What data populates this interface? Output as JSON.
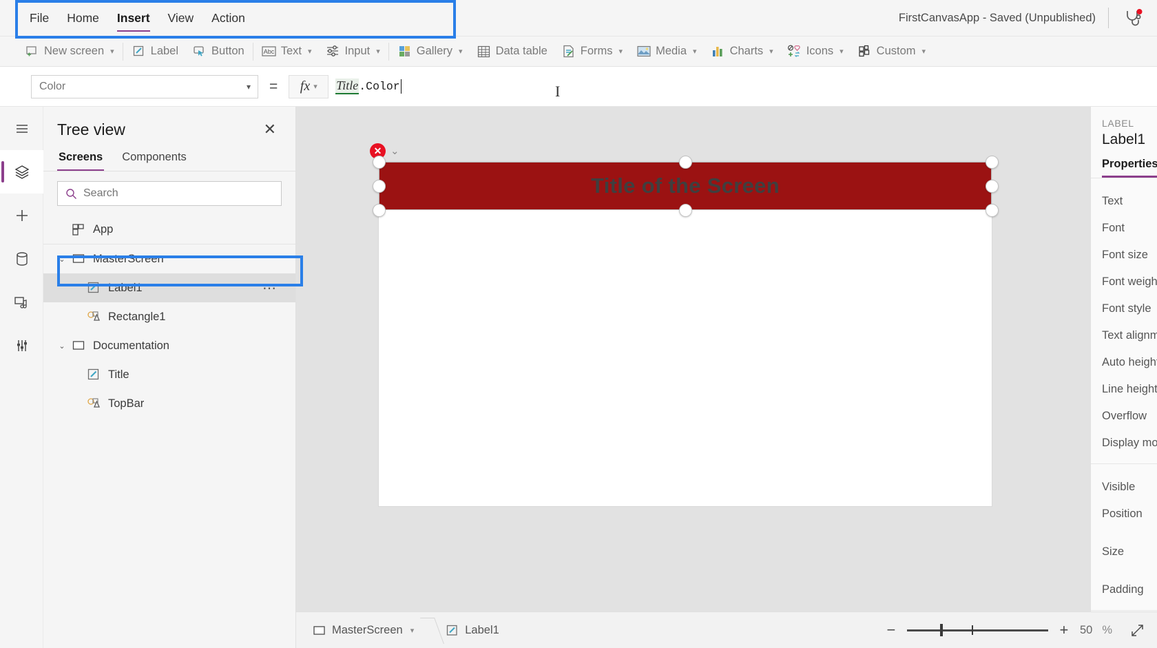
{
  "menu": {
    "items": [
      {
        "label": "File",
        "active": false
      },
      {
        "label": "Home",
        "active": false
      },
      {
        "label": "Insert",
        "active": true
      },
      {
        "label": "View",
        "active": false
      },
      {
        "label": "Action",
        "active": false
      }
    ],
    "app_state": "FirstCanvasApp - Saved (Unpublished)",
    "health_icon": "stethoscope-icon"
  },
  "ribbon": {
    "items": [
      {
        "label": "New screen",
        "icon": "new-screen-icon",
        "caret": true
      },
      {
        "label": "Label",
        "icon": "label-icon",
        "caret": false
      },
      {
        "label": "Button",
        "icon": "button-icon",
        "caret": false
      },
      {
        "label": "Text",
        "icon": "text-icon",
        "caret": true
      },
      {
        "label": "Input",
        "icon": "input-icon",
        "caret": true
      },
      {
        "label": "Gallery",
        "icon": "gallery-icon",
        "caret": true
      },
      {
        "label": "Data table",
        "icon": "data-table-icon",
        "caret": false
      },
      {
        "label": "Forms",
        "icon": "forms-icon",
        "caret": true
      },
      {
        "label": "Media",
        "icon": "media-icon",
        "caret": true
      },
      {
        "label": "Charts",
        "icon": "charts-icon",
        "caret": true
      },
      {
        "label": "Icons",
        "icon": "icons-icon",
        "caret": true
      },
      {
        "label": "Custom",
        "icon": "custom-icon",
        "caret": true
      }
    ]
  },
  "formula_bar": {
    "property_selected": "Color",
    "equals": "=",
    "fx_label": "fx",
    "formula_table_token": "Title",
    "formula_rest_token": ".Color",
    "highlighted": true
  },
  "rail": {
    "items": [
      {
        "name": "hamburger-menu-icon",
        "label": "Menu",
        "active": false
      },
      {
        "name": "tree-view-icon",
        "label": "Tree view",
        "active": true
      },
      {
        "name": "insert-plus-icon",
        "label": "Insert",
        "active": false
      },
      {
        "name": "data-icon",
        "label": "Data",
        "active": false
      },
      {
        "name": "media-icon",
        "label": "Media",
        "active": false
      },
      {
        "name": "variables-icon",
        "label": "Variables",
        "active": false
      }
    ]
  },
  "tree_view": {
    "title": "Tree view",
    "close_label": "✕",
    "tabs": [
      {
        "label": "Screens",
        "active": true
      },
      {
        "label": "Components",
        "active": false
      }
    ],
    "search_placeholder": "Search",
    "search_value": "",
    "nodes": [
      {
        "label": "App",
        "icon": "app-icon",
        "level": 0,
        "twisty": "",
        "selected": false,
        "ellipsis": false
      },
      {
        "label": "MasterScreen",
        "icon": "screen-icon",
        "level": 0,
        "twisty": "⌄",
        "selected": false,
        "ellipsis": false
      },
      {
        "label": "Label1",
        "icon": "label-control-icon",
        "level": 1,
        "twisty": "",
        "selected": true,
        "ellipsis": true
      },
      {
        "label": "Rectangle1",
        "icon": "shape-control-icon",
        "level": 1,
        "twisty": "",
        "selected": false,
        "ellipsis": false
      },
      {
        "label": "Documentation",
        "icon": "screen-icon",
        "level": 0,
        "twisty": "⌄",
        "selected": false,
        "ellipsis": false
      },
      {
        "label": "Title",
        "icon": "label-control-icon",
        "level": 1,
        "twisty": "",
        "selected": false,
        "ellipsis": false
      },
      {
        "label": "TopBar",
        "icon": "shape-control-icon",
        "level": 1,
        "twisty": "",
        "selected": false,
        "ellipsis": false
      }
    ]
  },
  "canvas": {
    "label_text": "Title of the Screen",
    "label_fill": "#9b1212",
    "label_text_color": "#3f3f3f",
    "screen_background": "#ffffff",
    "error_badge": "✕",
    "error_chevron": "⌄"
  },
  "properties_panel": {
    "kind": "LABEL",
    "name": "Label1",
    "tab": "Properties",
    "group1": [
      "Text",
      "Font",
      "Font size",
      "Font weight",
      "Font style",
      "Text alignment",
      "Auto height",
      "Line height",
      "Overflow",
      "Display mode"
    ],
    "group2": [
      "Visible",
      "Position",
      "Size",
      "Padding"
    ]
  },
  "status_bar": {
    "breadcrumbs": [
      {
        "label": "MasterScreen",
        "icon": "screen-icon",
        "caret": true
      },
      {
        "label": "Label1",
        "icon": "label-control-icon",
        "caret": false
      }
    ],
    "zoom_minus": "−",
    "zoom_plus": "+",
    "zoom_value": "50",
    "zoom_unit": "%",
    "fit_icon": "fit-to-screen-icon"
  },
  "colors": {
    "accent_purple": "#8c3f8c",
    "highlight_blue": "#2a7fe8",
    "error_red": "#e81123",
    "canvas_gray": "#e2e2e2"
  }
}
